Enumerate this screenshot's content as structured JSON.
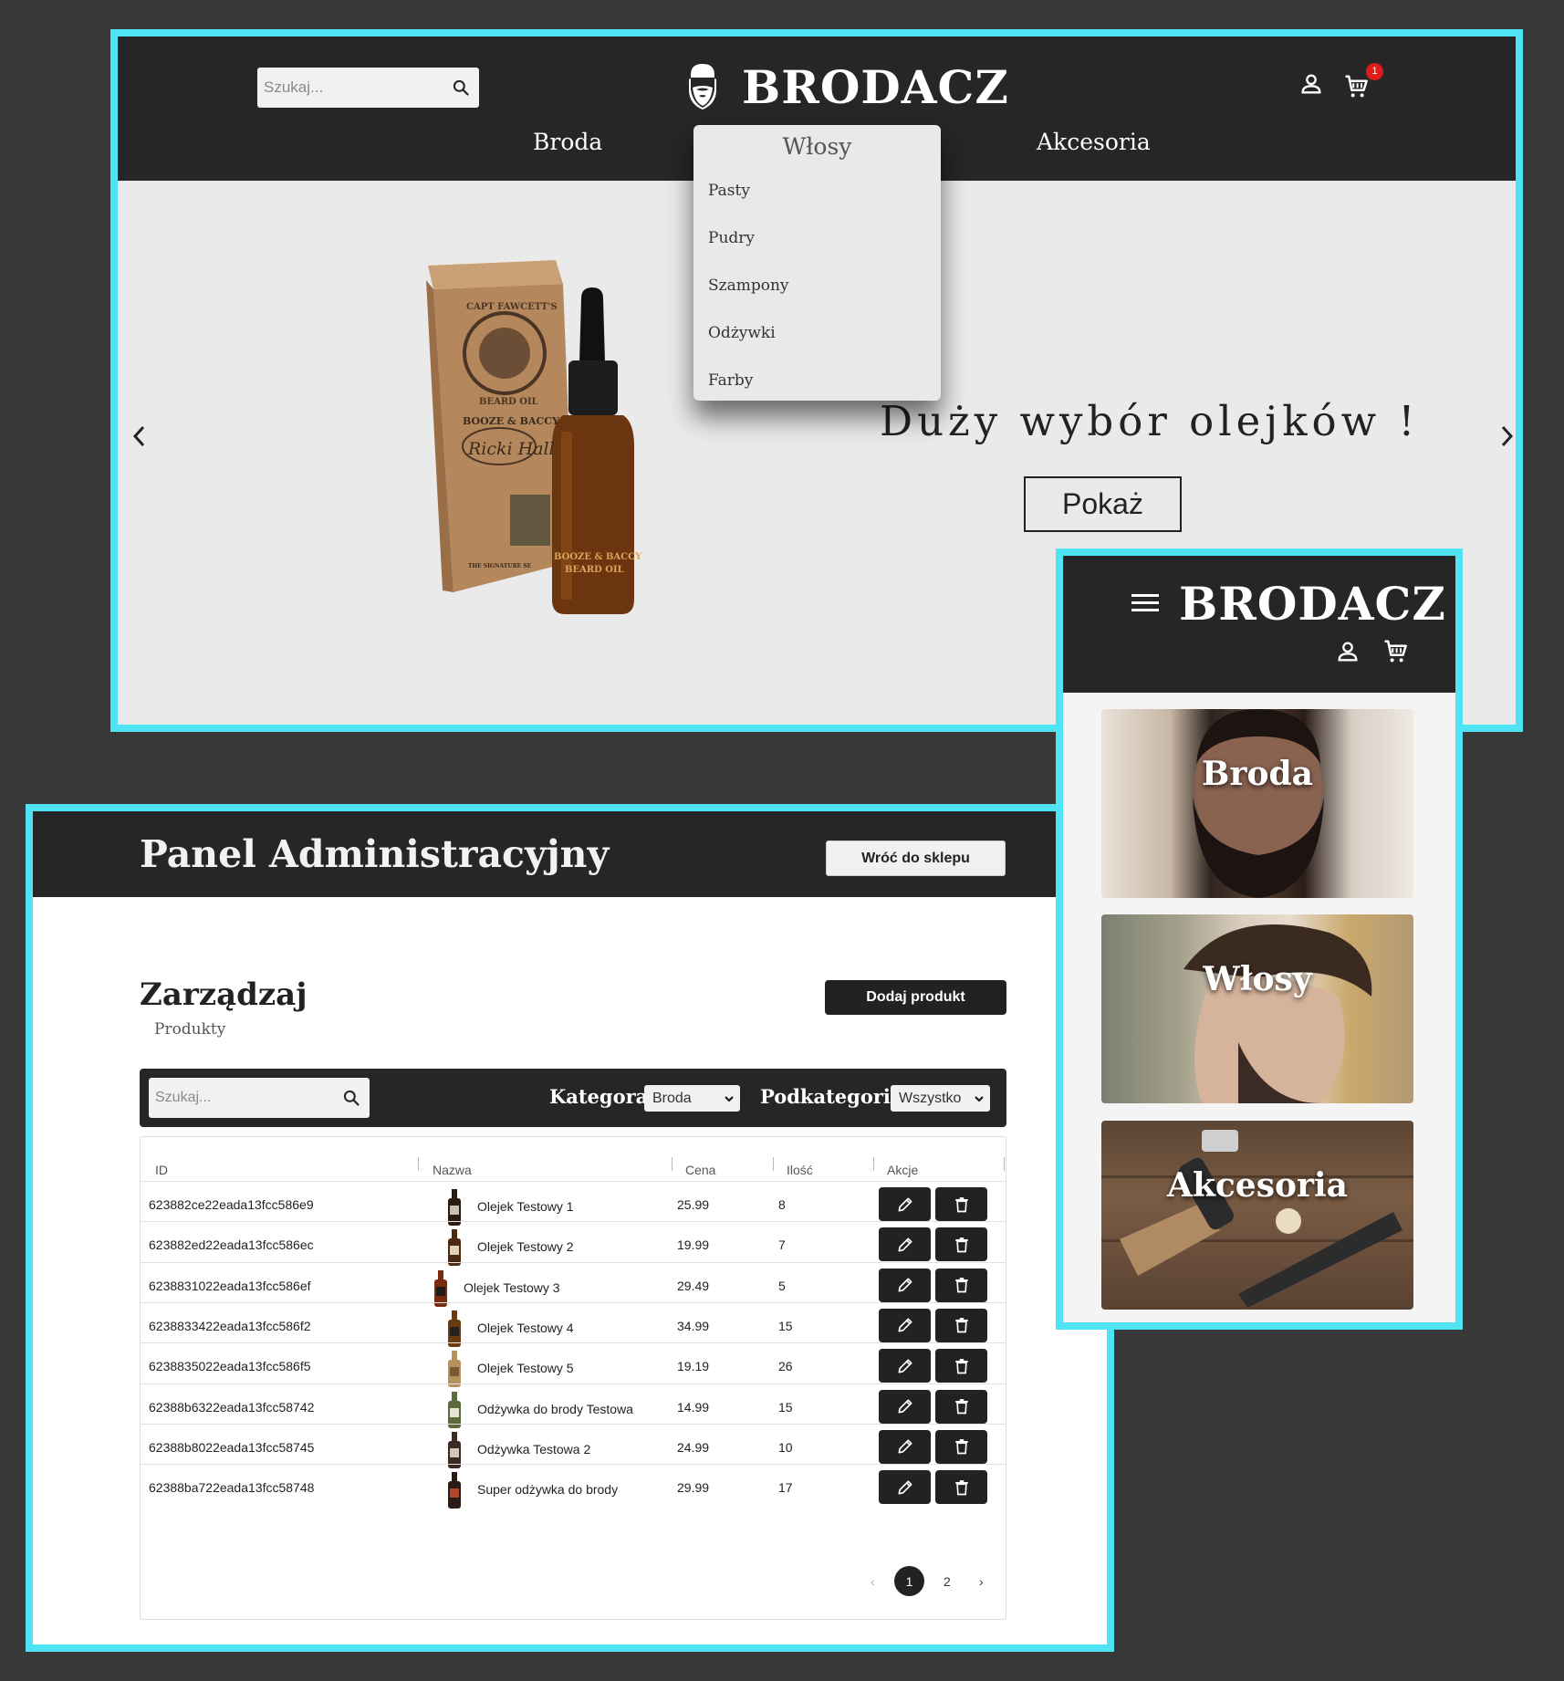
{
  "shop": {
    "search_placeholder": "Szukaj...",
    "logo": "BRODACZ",
    "cart_count": "1",
    "nav": {
      "broda": "Broda",
      "wlosy": "Włosy",
      "akcesoria": "Akcesoria"
    },
    "dropdown_items": [
      "Pasty",
      "Pudry",
      "Szampony",
      "Odżywki",
      "Farby"
    ],
    "slide_text": "Duży wybór olejków !",
    "slide_button": "Pokaż",
    "product_label_top": "CAPT FAWCETT'S",
    "product_label_mid": "BEARD OIL",
    "product_label_brand": "BOOZE & BACCY",
    "product_label_script": "Ricki Hall",
    "bottle_label_1": "BOOZE & BACCY",
    "bottle_label_2": "BEARD OIL",
    "box_bottom_text": "THE SIGNATURE SE"
  },
  "admin": {
    "title": "Panel Administracyjny",
    "back_button": "Wróć do sklepu",
    "section_title": "Zarządzaj",
    "section_sub": "Produkty",
    "add_button": "Dodaj produkt",
    "search_placeholder": "Szukaj...",
    "category_label": "Kategora:",
    "category_value": "Broda",
    "subcategory_label": "Podkategoria:",
    "subcategory_value": "Wszystko",
    "columns": [
      "ID",
      "Nazwa",
      "Cena",
      "Ilość",
      "Akcje"
    ],
    "rows": [
      {
        "id": "623882ce22eada13fcc586e9",
        "name": "Olejek Testowy 1",
        "price": "25.99",
        "qty": "8"
      },
      {
        "id": "623882ed22eada13fcc586ec",
        "name": "Olejek Testowy 2",
        "price": "19.99",
        "qty": "7"
      },
      {
        "id": "6238831022eada13fcc586ef",
        "name": "Olejek Testowy 3",
        "price": "29.49",
        "qty": "5"
      },
      {
        "id": "6238833422eada13fcc586f2",
        "name": "Olejek Testowy 4",
        "price": "34.99",
        "qty": "15"
      },
      {
        "id": "6238835022eada13fcc586f5",
        "name": "Olejek Testowy 5",
        "price": "19.19",
        "qty": "26"
      },
      {
        "id": "62388b6322eada13fcc58742",
        "name": "Odżywka do brody Testowa",
        "price": "14.99",
        "qty": "15"
      },
      {
        "id": "62388b8022eada13fcc58745",
        "name": "Odżywka Testowa 2",
        "price": "24.99",
        "qty": "10"
      },
      {
        "id": "62388ba722eada13fcc58748",
        "name": "Super odżywka do brody",
        "price": "29.99",
        "qty": "17"
      }
    ],
    "pagination": {
      "prev": "‹",
      "current": "1",
      "next_page": "2",
      "next": "›"
    }
  },
  "mobile": {
    "logo": "BRODACZ",
    "cards": [
      "Broda",
      "Włosy",
      "Akcesoria"
    ]
  },
  "colors": {
    "accent_border": "#4fe4f4",
    "header": "#262626",
    "badge": "#e11a1a"
  }
}
